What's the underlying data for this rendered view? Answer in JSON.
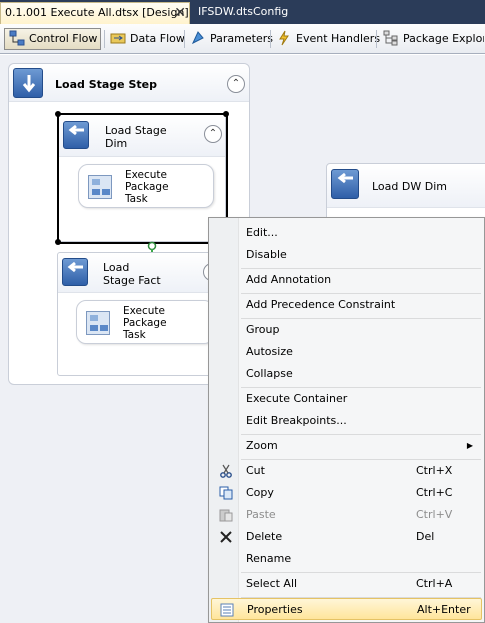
{
  "doc_tabs": [
    {
      "label": "0.1.001 Execute All.dtsx [Design]",
      "close": "✕"
    },
    {
      "label": "IFSDW.dtsConfig"
    }
  ],
  "designer_tabs": [
    {
      "label": "Control Flow",
      "icon": "control-flow-icon"
    },
    {
      "label": "Data Flow",
      "icon": "data-flow-icon"
    },
    {
      "label": "Parameters",
      "icon": "parameters-icon"
    },
    {
      "label": "Event Handlers",
      "icon": "event-handlers-icon"
    },
    {
      "label": "Package Explore",
      "icon": "package-explorer-icon"
    }
  ],
  "canvas": {
    "outer_container": {
      "title": "Load Stage Step",
      "collapse": "⌃"
    },
    "dim_container": {
      "title": "Load Stage Dim",
      "collapse": "⌃",
      "task": "Execute Package Task"
    },
    "fact_container": {
      "title": "Load Stage Fact",
      "task": "Execute Package Task"
    },
    "dw_container": {
      "title": "Load DW Dim"
    }
  },
  "context_menu": {
    "items": [
      {
        "label": "Edit..."
      },
      {
        "label": "Disable"
      },
      {
        "label": "Add Annotation"
      },
      {
        "label": "Add Precedence Constraint"
      },
      {
        "label": "Group"
      },
      {
        "label": "Autosize"
      },
      {
        "label": "Collapse"
      },
      {
        "label": "Execute Container"
      },
      {
        "label": "Edit Breakpoints..."
      },
      {
        "label": "Zoom",
        "submenu": "▶"
      },
      {
        "label": "Cut",
        "shortcut": "Ctrl+X",
        "icon": "scissors-icon"
      },
      {
        "label": "Copy",
        "shortcut": "Ctrl+C",
        "icon": "copy-icon"
      },
      {
        "label": "Paste",
        "shortcut": "Ctrl+V",
        "icon": "paste-icon",
        "disabled": true
      },
      {
        "label": "Delete",
        "shortcut": "Del",
        "icon": "delete-icon"
      },
      {
        "label": "Rename"
      },
      {
        "label": "Select All",
        "shortcut": "Ctrl+A"
      },
      {
        "label": "Properties",
        "shortcut": "Alt+Enter",
        "icon": "properties-icon",
        "highlighted": true
      }
    ]
  },
  "colors": {
    "tab_strip": "#2b3c59",
    "menu_highlight": "#ffe59b",
    "constraint_arrow": "#3aa84a"
  }
}
